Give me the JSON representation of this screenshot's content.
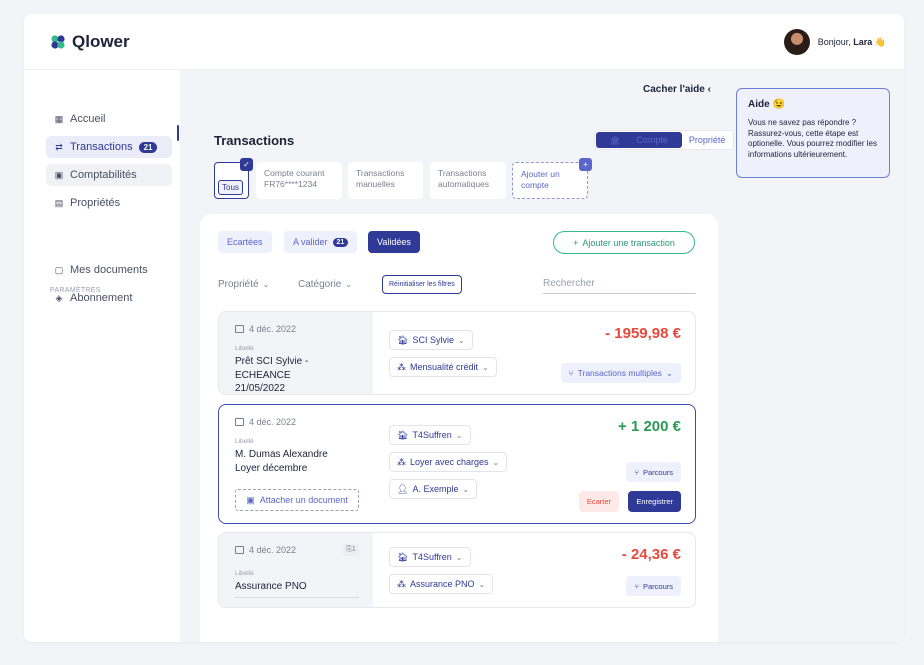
{
  "app": {
    "name": "Qlower",
    "greeting": "Bonjour,",
    "user_name": "Lara",
    "wave_emoji": "👋",
    "brand_color": "#2e3a96"
  },
  "sidebar": {
    "items": [
      {
        "label": "Accueil",
        "icon": "grid-icon"
      },
      {
        "label": "Transactions",
        "icon": "transfer-icon",
        "badge": "21"
      },
      {
        "label": "Comptabilités",
        "icon": "calculator-icon"
      },
      {
        "label": "Propriétés",
        "icon": "building-icon"
      }
    ],
    "section_label": "PARAMÈTRES",
    "settings_items": [
      {
        "label": "Mes documents",
        "icon": "document-icon"
      },
      {
        "label": "Abonnement",
        "icon": "tag-icon"
      }
    ]
  },
  "help": {
    "hide_label": "Cacher l'aide",
    "title": "Aide",
    "title_emoji": "😉",
    "text": "Vous ne savez pas répondre ? Rassurez-vous, cette étape est optionelle. Vous pourrez modifier les informations ultérieurement."
  },
  "page": {
    "title": "Transactions",
    "toggle": {
      "compte": "Compte",
      "propriete": "Propriété"
    }
  },
  "accounts": [
    {
      "label": "Tous"
    },
    {
      "line1": "Compte courant",
      "line2": "FR76****1234"
    },
    {
      "line1": "Transactions",
      "line2": "manuelles"
    },
    {
      "line1": "Transactions",
      "line2": "automatiques"
    },
    {
      "line1": "Ajouter un",
      "line2": "compte"
    }
  ],
  "tabs": {
    "ecartees": "Ecartées",
    "a_valider": "A valider",
    "a_valider_count": "21",
    "validees": "Validées",
    "add_transaction": "Ajouter une transaction"
  },
  "filters": {
    "propriete": "Propriété",
    "categorie": "Catégorie",
    "reset": "Réinitialiser les filtres",
    "search_placeholder": "Rechercher"
  },
  "transactions": [
    {
      "date": "4 déc. 2022",
      "libelle_label": "Libellé",
      "name_line1": "Prêt SCI Sylvie - ECHEANCE",
      "name_line2": "21/05/2022",
      "property": "SCI Sylvie",
      "category": "Mensualité crédit",
      "amount": "- 1959,98 €",
      "multi_label": "Transactions multiples"
    },
    {
      "date": "4 déc. 2022",
      "libelle_label": "Libellé",
      "name_line1": "M. Dumas Alexandre",
      "name_line2": "Loyer décembre",
      "attach_label": "Attacher un document",
      "property": "T4Suffren",
      "category": "Loyer avec charges",
      "tenant": "A. Exemple",
      "amount": "+ 1 200 €",
      "parcours": "Parcours",
      "ecarter": "Ecarter",
      "save": "Enregistrer"
    },
    {
      "date": "4 déc. 2022",
      "attachment_count": "1",
      "libelle_label": "Libellé",
      "name_line1": "Assurance PNO",
      "property": "T4Suffren",
      "category": "Assurance PNO",
      "amount": "- 24,36 €",
      "parcours": "Parcours"
    }
  ]
}
